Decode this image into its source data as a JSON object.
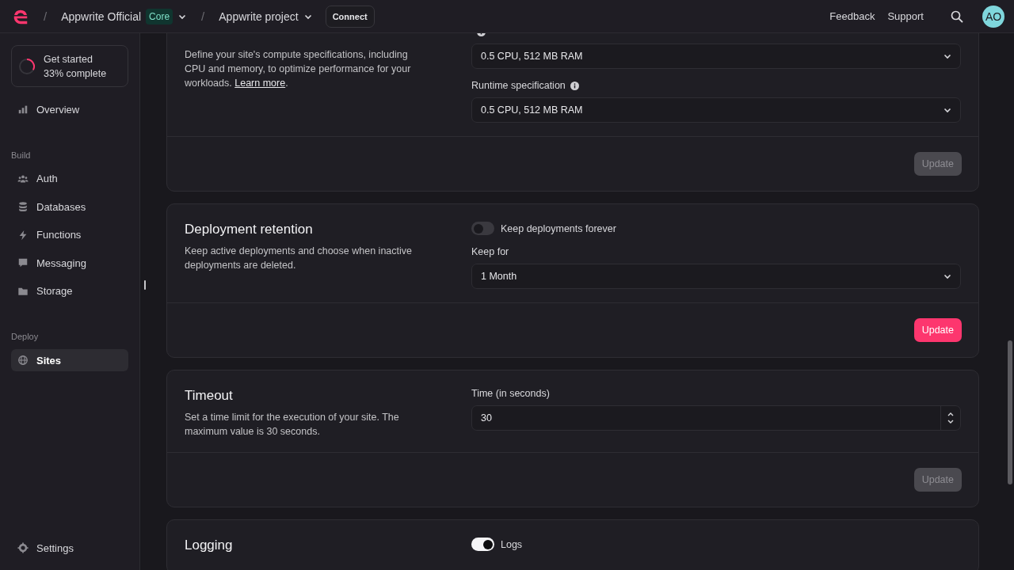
{
  "header": {
    "breadcrumbs": [
      {
        "separator": "/",
        "label": "Appwrite Official",
        "badge": "Core"
      },
      {
        "separator": "/",
        "label": "Appwrite project"
      }
    ],
    "connect": "Connect",
    "links": [
      "Feedback",
      "Support"
    ],
    "avatar": "AO"
  },
  "sidebar": {
    "progress": {
      "title": "Get started",
      "subtitle": "33% complete",
      "level": 0.33
    },
    "sections": [
      {
        "items": [
          {
            "label": "Overview",
            "selected": false
          }
        ]
      },
      {
        "heading": "Build",
        "items": [
          {
            "label": "Auth",
            "selected": false
          },
          {
            "label": "Databases",
            "selected": false
          },
          {
            "label": "Functions",
            "selected": false
          },
          {
            "label": "Messaging",
            "selected": false
          },
          {
            "label": "Storage",
            "selected": false
          }
        ]
      },
      {
        "heading": "Deploy",
        "items": [
          {
            "label": "Sites",
            "selected": true
          }
        ]
      }
    ],
    "footer": {
      "label": "Settings",
      "selected": false
    }
  },
  "cards": [
    {
      "description": "Define your site's compute specifications, including CPU and memory, to optimize performance for your workloads. ",
      "link": "Learn more",
      "trailing": ".",
      "fields": [
        {
          "kind": "select",
          "info": true,
          "value": "0.5 CPU, 512 MB RAM"
        },
        {
          "kind": "select",
          "label": "Runtime specification",
          "info": true,
          "value": "0.5 CPU, 512 MB RAM"
        }
      ],
      "button": {
        "label": "Update",
        "disabled": true
      }
    },
    {
      "title": "Deployment retention",
      "description": "Keep active deployments and choose when inactive deployments are deleted.",
      "fields": [
        {
          "kind": "toggle",
          "label": "Keep deployments forever",
          "on": false
        },
        {
          "kind": "select",
          "label": "Keep for",
          "info": false,
          "value": "1 Month"
        }
      ],
      "button": {
        "label": "Update",
        "disabled": false
      }
    },
    {
      "title": "Timeout",
      "description": "Set a time limit for the execution of your site. The maximum value is 30 seconds.",
      "fields": [
        {
          "kind": "number",
          "label": "Time (in seconds)",
          "value": "30"
        }
      ],
      "button": {
        "label": "Update",
        "disabled": true
      }
    },
    {
      "title": "Logging",
      "fields": [
        {
          "kind": "toggle",
          "label": "Logs",
          "on": true
        }
      ]
    }
  ]
}
